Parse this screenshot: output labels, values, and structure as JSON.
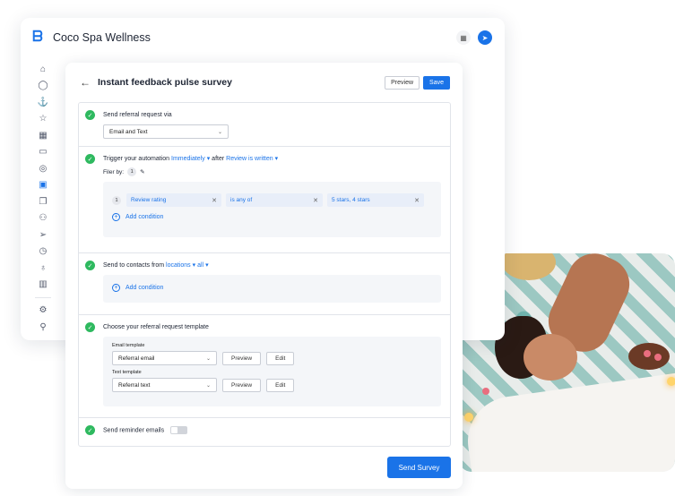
{
  "app": {
    "business_name": "Coco Spa Wellness",
    "logo_icon": "brand-logo-icon",
    "accent_color": "#1a73e8",
    "sidebar_icons": [
      "home-icon",
      "chat-icon",
      "anchor-icon",
      "star-icon",
      "grid-icon",
      "calendar-icon",
      "target-icon",
      "survey-icon",
      "copy-icon",
      "people-icon",
      "send-icon",
      "history-icon",
      "bulb-icon",
      "chart-icon",
      "settings-icon",
      "user-icon"
    ]
  },
  "survey": {
    "title": "Instant feedback pulse survey",
    "preview_label": "Preview",
    "save_label": "Save",
    "send_label": "Send Survey",
    "success_color": "#2eb95f",
    "step1": {
      "title": "Send referral request via",
      "channel_value": "Email and Text"
    },
    "step2": {
      "title_prefix": "Trigger your automation",
      "timing": "Immediately",
      "after_word": "after",
      "event": "Review is written",
      "filter_label": "Filer by:",
      "filter_count": "1",
      "condition_number": "1",
      "condition_field": "Review rating",
      "condition_operator": "is any of",
      "condition_value": "5 stars, 4 stars",
      "add_condition": "Add condition"
    },
    "step3": {
      "title_prefix": "Send to contacts from",
      "source": "locations",
      "scope": "all",
      "add_condition": "Add condition"
    },
    "step4": {
      "title": "Choose your referral request template",
      "email_label": "Email template",
      "email_value": "Referral email",
      "text_label": "Text template",
      "text_value": "Referral text",
      "preview_label": "Preview",
      "edit_label": "Edit"
    },
    "step5": {
      "title": "Send reminder emails",
      "toggle_on": false
    }
  }
}
